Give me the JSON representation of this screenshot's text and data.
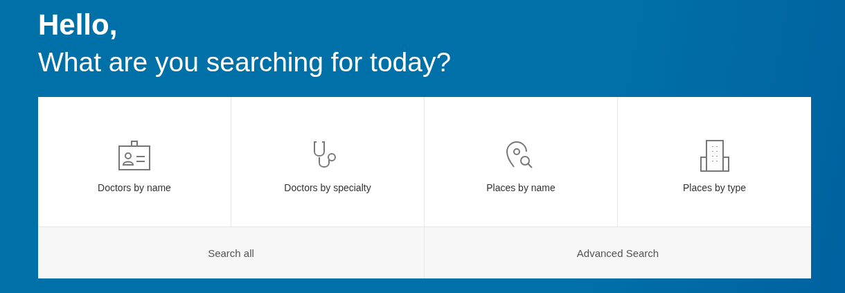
{
  "greeting": "Hello,",
  "heading": "What are you searching for today?",
  "options": [
    {
      "label": "Doctors by name",
      "kind": "badge"
    },
    {
      "label": "Doctors by specialty",
      "kind": "stethoscope"
    },
    {
      "label": "Places by name",
      "kind": "pin-search"
    },
    {
      "label": "Places by type",
      "kind": "building"
    }
  ],
  "links": [
    "Search all",
    "Advanced Search"
  ]
}
